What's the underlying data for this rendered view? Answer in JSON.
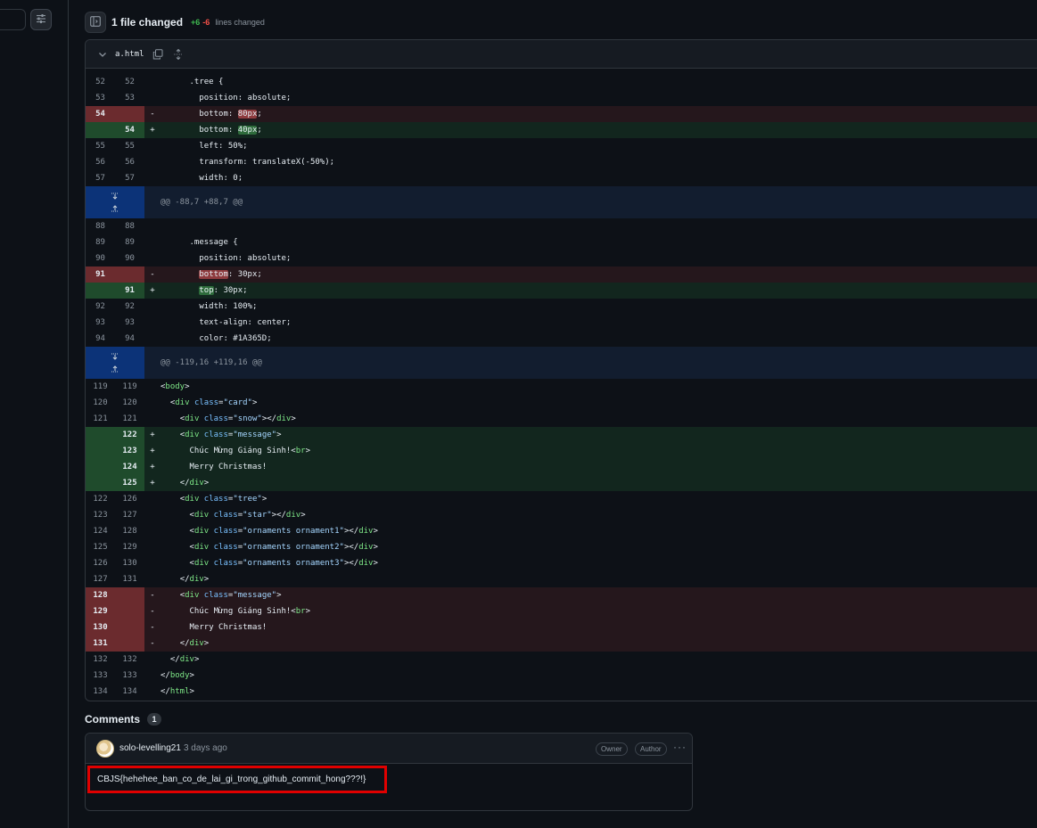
{
  "header": {
    "files_changed": "1 file changed",
    "additions": "+6",
    "deletions": "-6",
    "stat_label": "lines changed"
  },
  "file": {
    "name": "a.html"
  },
  "diff_rows": [
    {
      "type": "ctx",
      "old": "52",
      "new": "52",
      "code": "      .tree {"
    },
    {
      "type": "ctx",
      "old": "53",
      "new": "53",
      "code": "        position: absolute;"
    },
    {
      "type": "del",
      "old": "54",
      "new": "",
      "pre": "        bottom: ",
      "hl": "80px",
      "post": ";"
    },
    {
      "type": "add",
      "old": "",
      "new": "54",
      "pre": "        bottom: ",
      "hl": "40px",
      "post": ";"
    },
    {
      "type": "ctx",
      "old": "55",
      "new": "55",
      "code": "        left: 50%;"
    },
    {
      "type": "ctx",
      "old": "56",
      "new": "56",
      "code": "        transform: translateX(-50%);"
    },
    {
      "type": "ctx",
      "old": "57",
      "new": "57",
      "code": "        width: 0;"
    },
    {
      "type": "hunk",
      "code": "@@ -88,7 +88,7 @@"
    },
    {
      "type": "ctx",
      "old": "88",
      "new": "88",
      "code": ""
    },
    {
      "type": "ctx",
      "old": "89",
      "new": "89",
      "code": "      .message {"
    },
    {
      "type": "ctx",
      "old": "90",
      "new": "90",
      "code": "        position: absolute;"
    },
    {
      "type": "del",
      "old": "91",
      "new": "",
      "pre": "        ",
      "hl": "bottom",
      "post": ": 30px;"
    },
    {
      "type": "add",
      "old": "",
      "new": "91",
      "pre": "        ",
      "hl": "top",
      "post": ": 30px;"
    },
    {
      "type": "ctx",
      "old": "92",
      "new": "92",
      "code": "        width: 100%;"
    },
    {
      "type": "ctx",
      "old": "93",
      "new": "93",
      "code": "        text-align: center;"
    },
    {
      "type": "ctx",
      "old": "94",
      "new": "94",
      "code": "        color: #1A365D;"
    },
    {
      "type": "hunk",
      "code": "@@ -119,16 +119,16 @@"
    },
    {
      "type": "ctx",
      "old": "119",
      "new": "119",
      "html": [
        [
          "",
          "<"
        ],
        [
          "t",
          "body"
        ],
        [
          "",
          ">"
        ]
      ],
      "indent": ""
    },
    {
      "type": "ctx",
      "old": "120",
      "new": "120",
      "html": [
        [
          "",
          "<"
        ],
        [
          "t",
          "div"
        ],
        [
          "",
          " "
        ],
        [
          "a",
          "class"
        ],
        [
          "",
          "="
        ],
        [
          "s",
          "\"card\""
        ],
        [
          "",
          ">"
        ]
      ],
      "indent": "  "
    },
    {
      "type": "ctx",
      "old": "121",
      "new": "121",
      "html": [
        [
          "",
          "<"
        ],
        [
          "t",
          "div"
        ],
        [
          "",
          " "
        ],
        [
          "a",
          "class"
        ],
        [
          "",
          "="
        ],
        [
          "s",
          "\"snow\""
        ],
        [
          "",
          "></"
        ],
        [
          "t",
          "div"
        ],
        [
          "",
          ">"
        ]
      ],
      "indent": "    "
    },
    {
      "type": "add",
      "old": "",
      "new": "122",
      "html": [
        [
          "",
          "<"
        ],
        [
          "t",
          "div"
        ],
        [
          "",
          " "
        ],
        [
          "a",
          "class"
        ],
        [
          "",
          "="
        ],
        [
          "s",
          "\"message\""
        ],
        [
          "",
          ">"
        ]
      ],
      "indent": "    "
    },
    {
      "type": "add",
      "old": "",
      "new": "123",
      "html": [
        [
          "",
          "Chúc Mừng Giáng Sinh!<"
        ],
        [
          "t",
          "br"
        ],
        [
          "",
          ">"
        ]
      ],
      "indent": "      "
    },
    {
      "type": "add",
      "old": "",
      "new": "124",
      "html": [
        [
          "",
          "Merry Christmas!"
        ]
      ],
      "indent": "      "
    },
    {
      "type": "add",
      "old": "",
      "new": "125",
      "html": [
        [
          "",
          "</"
        ],
        [
          "t",
          "div"
        ],
        [
          "",
          ">"
        ]
      ],
      "indent": "    "
    },
    {
      "type": "ctx",
      "old": "122",
      "new": "126",
      "html": [
        [
          "",
          "<"
        ],
        [
          "t",
          "div"
        ],
        [
          "",
          " "
        ],
        [
          "a",
          "class"
        ],
        [
          "",
          "="
        ],
        [
          "s",
          "\"tree\""
        ],
        [
          "",
          ">"
        ]
      ],
      "indent": "    "
    },
    {
      "type": "ctx",
      "old": "123",
      "new": "127",
      "html": [
        [
          "",
          "<"
        ],
        [
          "t",
          "div"
        ],
        [
          "",
          " "
        ],
        [
          "a",
          "class"
        ],
        [
          "",
          "="
        ],
        [
          "s",
          "\"star\""
        ],
        [
          "",
          "></"
        ],
        [
          "t",
          "div"
        ],
        [
          "",
          ">"
        ]
      ],
      "indent": "      "
    },
    {
      "type": "ctx",
      "old": "124",
      "new": "128",
      "html": [
        [
          "",
          "<"
        ],
        [
          "t",
          "div"
        ],
        [
          "",
          " "
        ],
        [
          "a",
          "class"
        ],
        [
          "",
          "="
        ],
        [
          "s",
          "\"ornaments ornament1\""
        ],
        [
          "",
          "></"
        ],
        [
          "t",
          "div"
        ],
        [
          "",
          ">"
        ]
      ],
      "indent": "      "
    },
    {
      "type": "ctx",
      "old": "125",
      "new": "129",
      "html": [
        [
          "",
          "<"
        ],
        [
          "t",
          "div"
        ],
        [
          "",
          " "
        ],
        [
          "a",
          "class"
        ],
        [
          "",
          "="
        ],
        [
          "s",
          "\"ornaments ornament2\""
        ],
        [
          "",
          "></"
        ],
        [
          "t",
          "div"
        ],
        [
          "",
          ">"
        ]
      ],
      "indent": "      "
    },
    {
      "type": "ctx",
      "old": "126",
      "new": "130",
      "html": [
        [
          "",
          "<"
        ],
        [
          "t",
          "div"
        ],
        [
          "",
          " "
        ],
        [
          "a",
          "class"
        ],
        [
          "",
          "="
        ],
        [
          "s",
          "\"ornaments ornament3\""
        ],
        [
          "",
          "></"
        ],
        [
          "t",
          "div"
        ],
        [
          "",
          ">"
        ]
      ],
      "indent": "      "
    },
    {
      "type": "ctx",
      "old": "127",
      "new": "131",
      "html": [
        [
          "",
          "</"
        ],
        [
          "t",
          "div"
        ],
        [
          "",
          ">"
        ]
      ],
      "indent": "    "
    },
    {
      "type": "del",
      "old": "128",
      "new": "",
      "html": [
        [
          "",
          "<"
        ],
        [
          "t",
          "div"
        ],
        [
          "",
          " "
        ],
        [
          "a",
          "class"
        ],
        [
          "",
          "="
        ],
        [
          "s",
          "\"message\""
        ],
        [
          "",
          ">"
        ]
      ],
      "indent": "    "
    },
    {
      "type": "del",
      "old": "129",
      "new": "",
      "html": [
        [
          "",
          "Chúc Mừng Giáng Sinh!<"
        ],
        [
          "t",
          "br"
        ],
        [
          "",
          ">"
        ]
      ],
      "indent": "      "
    },
    {
      "type": "del",
      "old": "130",
      "new": "",
      "html": [
        [
          "",
          "Merry Christmas!"
        ]
      ],
      "indent": "      "
    },
    {
      "type": "del",
      "old": "131",
      "new": "",
      "html": [
        [
          "",
          "</"
        ],
        [
          "t",
          "div"
        ],
        [
          "",
          ">"
        ]
      ],
      "indent": "    "
    },
    {
      "type": "ctx",
      "old": "132",
      "new": "132",
      "html": [
        [
          "",
          "</"
        ],
        [
          "t",
          "div"
        ],
        [
          "",
          ">"
        ]
      ],
      "indent": "  "
    },
    {
      "type": "ctx",
      "old": "133",
      "new": "133",
      "html": [
        [
          "",
          "</"
        ],
        [
          "t",
          "body"
        ],
        [
          "",
          ">"
        ]
      ],
      "indent": ""
    },
    {
      "type": "ctx",
      "old": "134",
      "new": "134",
      "html": [
        [
          "",
          "</"
        ],
        [
          "t",
          "html"
        ],
        [
          "",
          ">"
        ]
      ],
      "indent": ""
    }
  ],
  "comments": {
    "title": "Comments",
    "count": "1",
    "items": [
      {
        "author": "solo-levelling21",
        "time": "3 days ago",
        "badges": [
          "Owner",
          "Author"
        ],
        "body": "CBJS{hehehee_ban_co_de_lai_gi_trong_github_commit_hong???!}"
      }
    ]
  },
  "icons": {
    "settings": "sliders-icon",
    "toggle": "sidebar-expand-icon",
    "chevron": "chevron-down-icon",
    "copy": "copy-icon",
    "expand": "unfold-icon"
  },
  "colors": {
    "background": "#0d1117",
    "addition": "#3fb950",
    "deletion": "#f85149",
    "highlight_border": "#e00000"
  }
}
